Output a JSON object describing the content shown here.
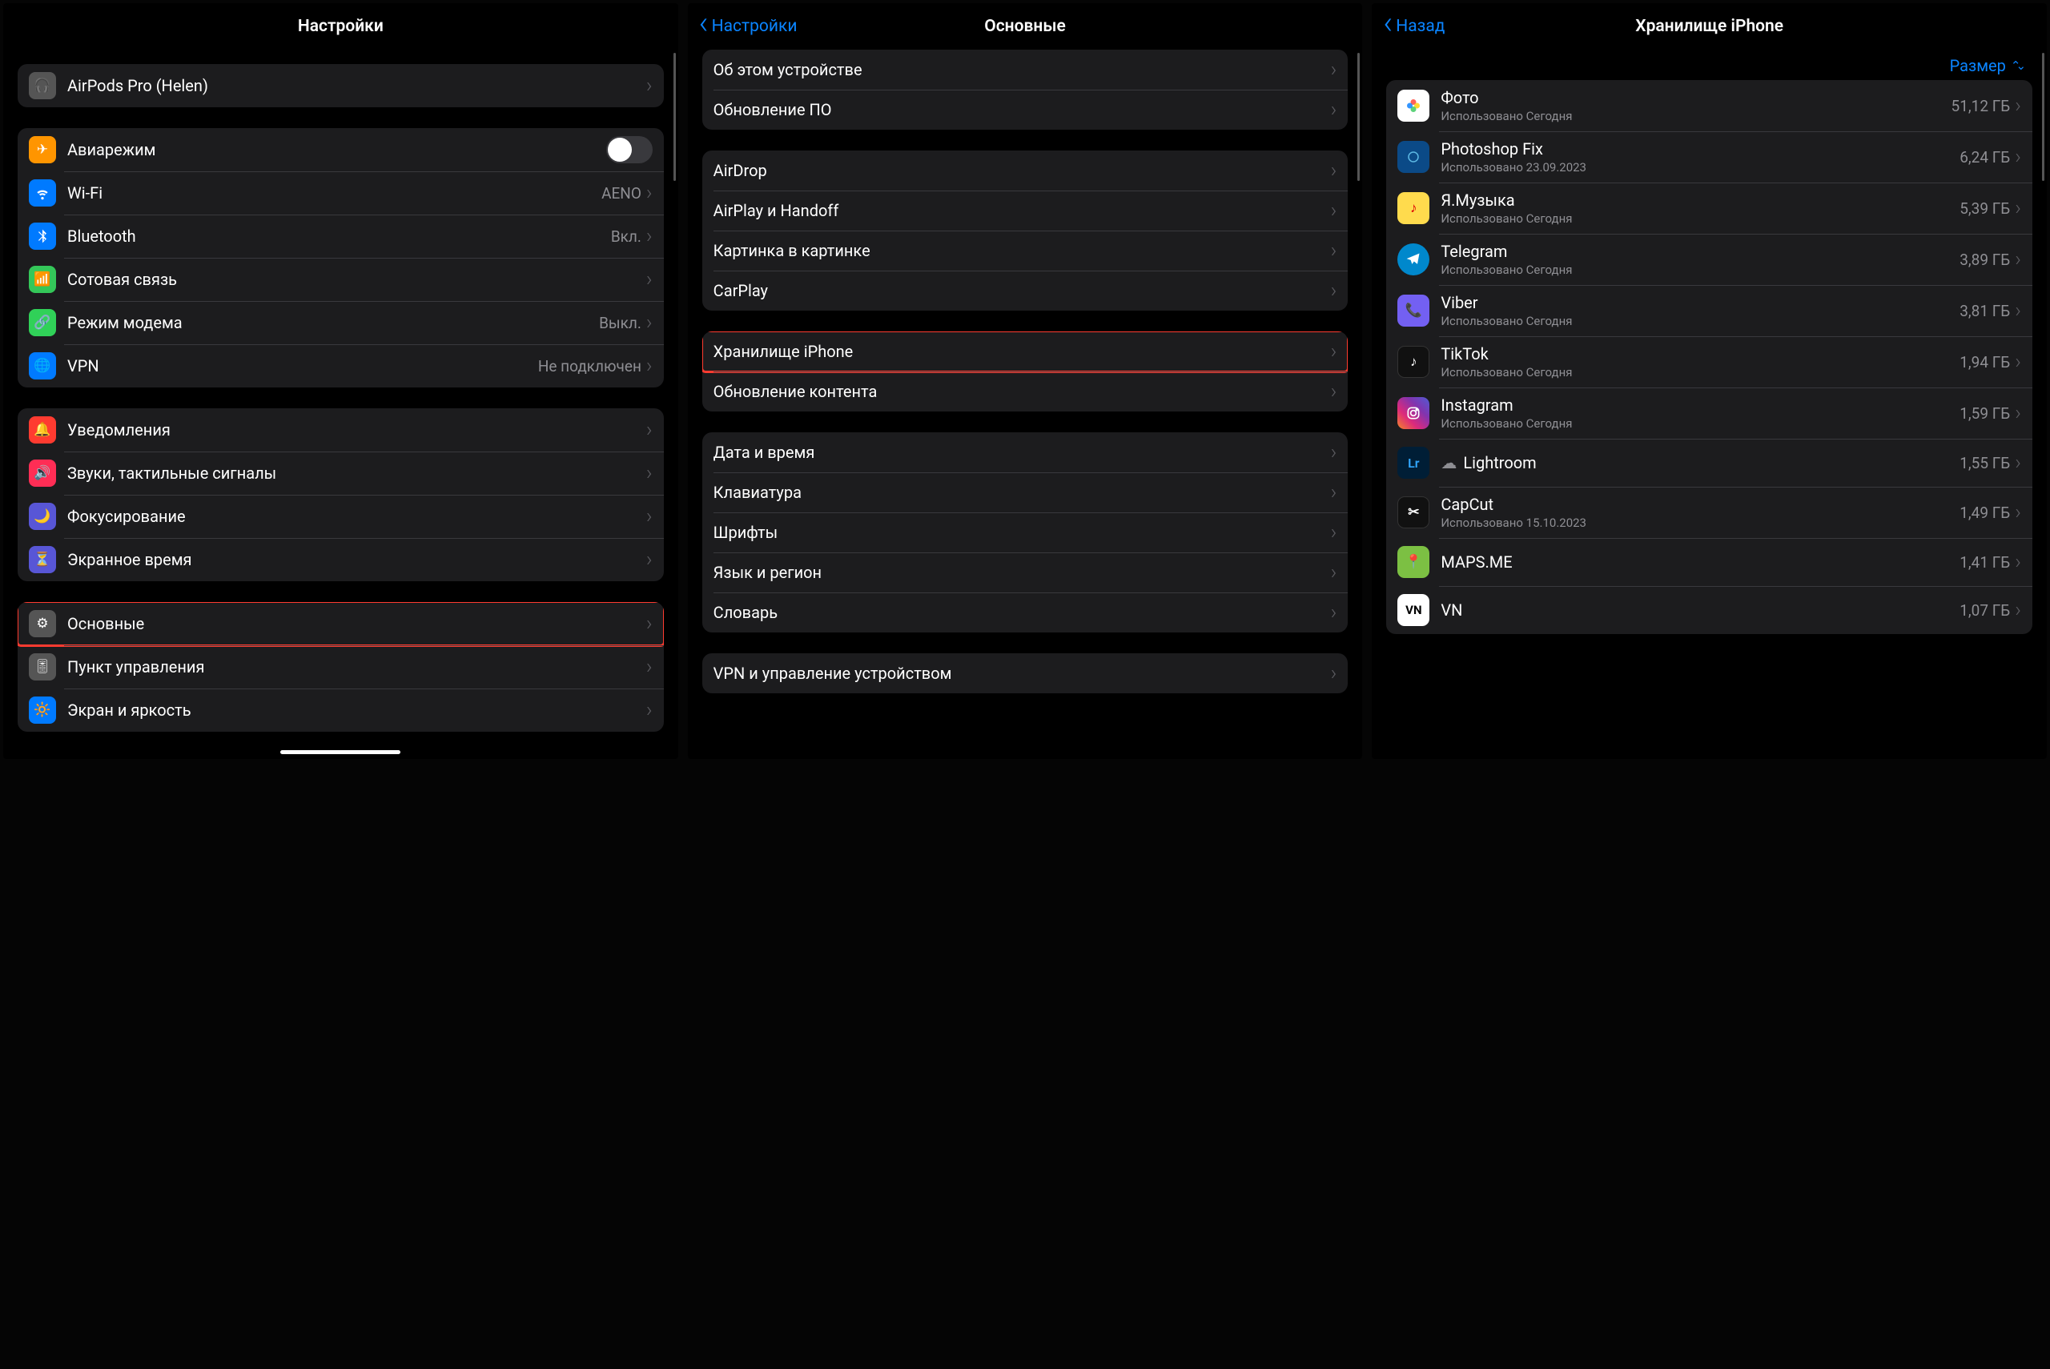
{
  "screen1": {
    "title": "Настройки",
    "rows": {
      "airpods": {
        "label": "AirPods Pro (Helen)"
      },
      "airplane": {
        "label": "Авиарежим"
      },
      "wifi": {
        "label": "Wi-Fi",
        "value": "AENO"
      },
      "bt": {
        "label": "Bluetooth",
        "value": "Вкл."
      },
      "cellular": {
        "label": "Сотовая связь"
      },
      "hotspot": {
        "label": "Режим модема",
        "value": "Выкл."
      },
      "vpn": {
        "label": "VPN",
        "value": "Не подключен"
      },
      "notif": {
        "label": "Уведомления"
      },
      "sounds": {
        "label": "Звуки, тактильные сигналы"
      },
      "focus": {
        "label": "Фокусирование"
      },
      "screentime": {
        "label": "Экранное время"
      },
      "general": {
        "label": "Основные"
      },
      "control": {
        "label": "Пункт управления"
      },
      "display": {
        "label": "Экран и яркость"
      }
    }
  },
  "screen2": {
    "back": "Настройки",
    "title": "Основные",
    "rows": {
      "about": "Об этом устройстве",
      "update": "Обновление ПО",
      "airdrop": "AirDrop",
      "airplay": "AirPlay и Handoff",
      "pip": "Картинка в картинке",
      "carplay": "CarPlay",
      "storage": "Хранилище iPhone",
      "refresh": "Обновление контента",
      "date": "Дата и время",
      "keyboard": "Клавиатура",
      "fonts": "Шрифты",
      "lang": "Язык и регион",
      "dict": "Словарь",
      "vpn": "VPN и управление устройством"
    }
  },
  "screen3": {
    "back": "Назад",
    "title": "Хранилище iPhone",
    "sort": "Размер",
    "apps": [
      {
        "name": "Фото",
        "sub": "Использовано Сегодня",
        "size": "51,12 ГБ",
        "icon": "photos"
      },
      {
        "name": "Photoshop Fix",
        "sub": "Использовано 23.09.2023",
        "size": "6,24 ГБ",
        "icon": "psfix"
      },
      {
        "name": "Я.Музыка",
        "sub": "Использовано Сегодня",
        "size": "5,39 ГБ",
        "icon": "ymusic"
      },
      {
        "name": "Telegram",
        "sub": "Использовано Сегодня",
        "size": "3,89 ГБ",
        "icon": "tg"
      },
      {
        "name": "Viber",
        "sub": "Использовано Сегодня",
        "size": "3,81 ГБ",
        "icon": "viber"
      },
      {
        "name": "TikTok",
        "sub": "Использовано Сегодня",
        "size": "1,94 ГБ",
        "icon": "tiktok"
      },
      {
        "name": "Instagram",
        "sub": "Использовано Сегодня",
        "size": "1,59 ГБ",
        "icon": "ig"
      },
      {
        "name": "Lightroom",
        "sub": "",
        "size": "1,55 ГБ",
        "icon": "lr",
        "cloud": true
      },
      {
        "name": "CapCut",
        "sub": "Использовано 15.10.2023",
        "size": "1,49 ГБ",
        "icon": "capcut"
      },
      {
        "name": "MAPS.ME",
        "sub": "",
        "size": "1,41 ГБ",
        "icon": "maps"
      },
      {
        "name": "VN",
        "sub": "",
        "size": "1,07 ГБ",
        "icon": "vn"
      }
    ]
  }
}
